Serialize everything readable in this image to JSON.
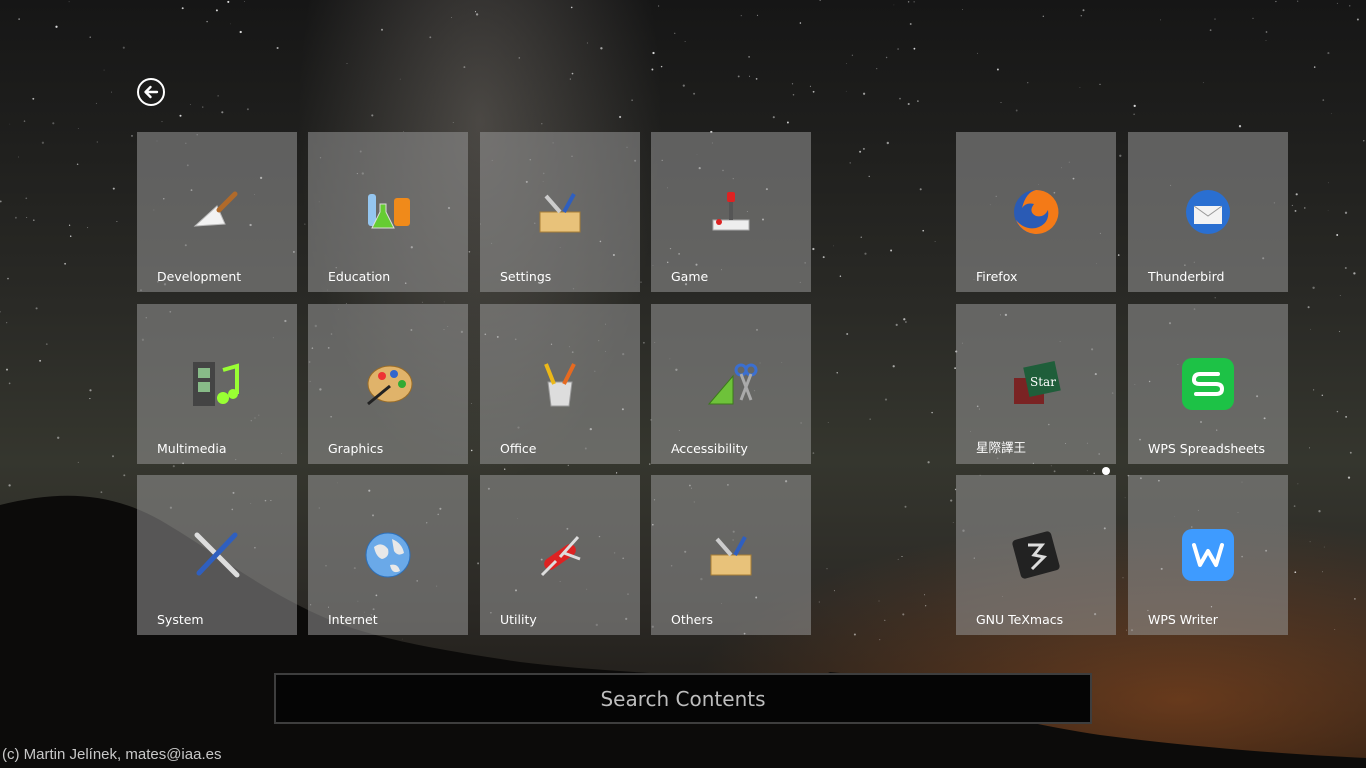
{
  "categories": [
    {
      "name": "development",
      "label": "Development",
      "icon": "trowel-icon"
    },
    {
      "name": "education",
      "label": "Education",
      "icon": "flasks-icon"
    },
    {
      "name": "settings",
      "label": "Settings",
      "icon": "toolbox-icon"
    },
    {
      "name": "game",
      "label": "Game",
      "icon": "joystick-icon"
    },
    {
      "name": "multimedia",
      "label": "Multimedia",
      "icon": "film-music-icon"
    },
    {
      "name": "graphics",
      "label": "Graphics",
      "icon": "palette-icon"
    },
    {
      "name": "office",
      "label": "Office",
      "icon": "pencil-cup-icon"
    },
    {
      "name": "accessibility",
      "label": "Accessibility",
      "icon": "ruler-scissors-icon"
    },
    {
      "name": "system",
      "label": "System",
      "icon": "wrench-screwdriver-icon"
    },
    {
      "name": "internet",
      "label": "Internet",
      "icon": "globe-icon"
    },
    {
      "name": "utility",
      "label": "Utility",
      "icon": "swiss-knife-icon"
    },
    {
      "name": "others",
      "label": "Others",
      "icon": "toolbox-icon"
    }
  ],
  "apps": [
    {
      "name": "firefox",
      "label": "Firefox",
      "icon": "firefox-icon"
    },
    {
      "name": "thunderbird",
      "label": "Thunderbird",
      "icon": "thunderbird-icon"
    },
    {
      "name": "star-dict",
      "label": "星際譯王",
      "icon": "stardict-book-icon"
    },
    {
      "name": "wps-spreadsheets",
      "label": "WPS Spreadsheets",
      "icon": "wps-spreadsheets-icon",
      "color": "#1dc246"
    },
    {
      "name": "texmacs",
      "label": "GNU TeXmacs",
      "icon": "texmacs-icon"
    },
    {
      "name": "wps-writer",
      "label": "WPS Writer",
      "icon": "wps-writer-icon",
      "color": "#3e9bff"
    }
  ],
  "search": {
    "placeholder": "Search Contents"
  },
  "credit": "(c) Martin Jelínek, mates@iaa.es",
  "back": {
    "icon": "back-arrow-icon"
  }
}
